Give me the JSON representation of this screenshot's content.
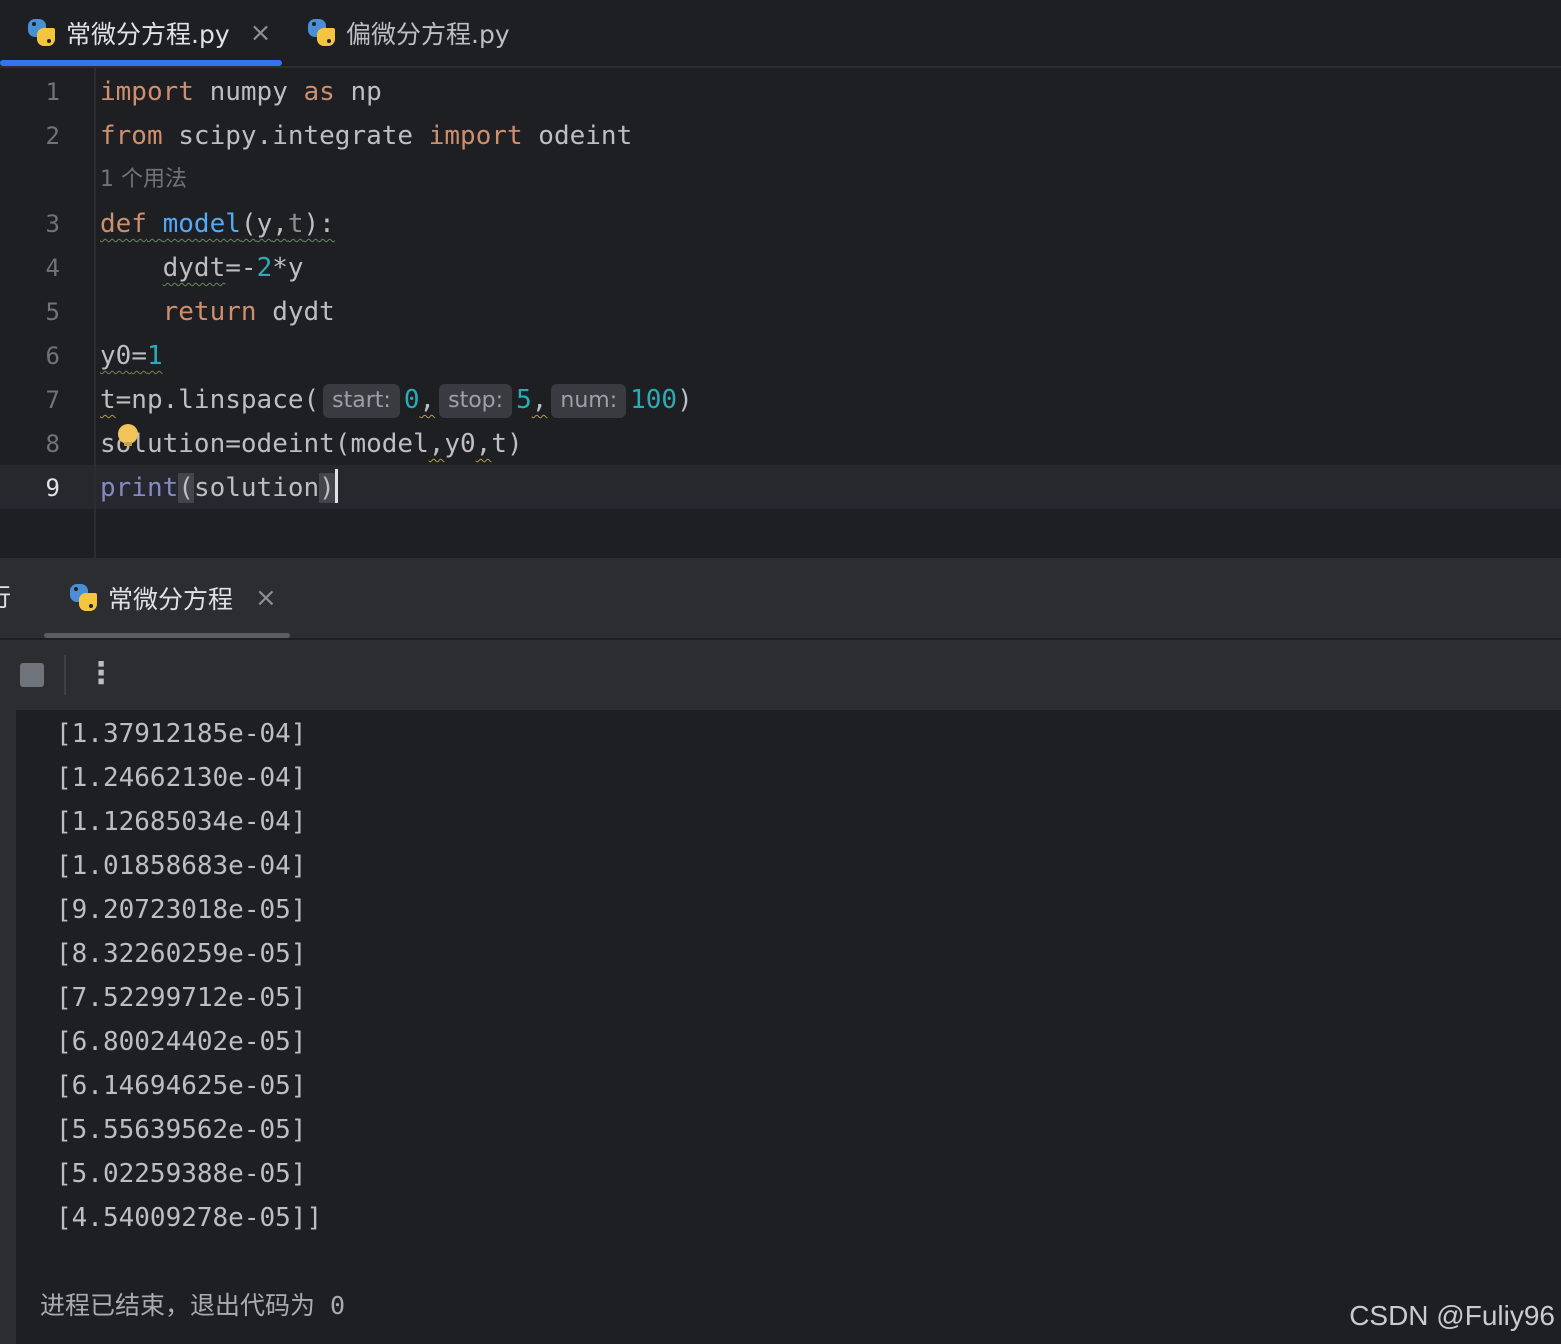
{
  "editor_tabs": [
    {
      "label": "常微分方程.py",
      "active": true,
      "close": "×"
    },
    {
      "label": "偏微分方程.py",
      "active": false
    }
  ],
  "editor": {
    "line_numbers": [
      "1",
      "2",
      "3",
      "4",
      "5",
      "6",
      "7",
      "8",
      "9"
    ],
    "usage_hint": "1 个用法",
    "lines": {
      "l1": {
        "kw1": "import",
        "t1": " numpy ",
        "kw2": "as",
        "t2": " np"
      },
      "l2": {
        "kw1": "from",
        "t1": " scipy.integrate ",
        "kw2": "import",
        "t2": " odeint"
      },
      "l3": {
        "kw": "def",
        "sp": " ",
        "fn": "model",
        "p1": "(",
        "a1": "y",
        "c": ",",
        "a2": "t",
        "p2": "):"
      },
      "l4": {
        "indent": "    ",
        "var": "dydt",
        "op": "=-",
        "num": "2",
        "rest": "*y"
      },
      "l5": {
        "indent": "    ",
        "kw": "return",
        "rest": " dydt"
      },
      "l6": {
        "var": "y0",
        "op": "=",
        "num": "1"
      },
      "l7": {
        "a": "t",
        "b": "=np.linspace(",
        "hint1": "start:",
        "n1": "0",
        "c1": ",",
        "hint2": "stop:",
        "n2": "5",
        "c2": ",",
        "hint3": "num:",
        "n3": "100",
        "end": ")"
      },
      "l8": {
        "a": "so",
        "b": "lution=odeint(model",
        "c1": ",",
        "d": "y0",
        "c2": ",",
        "e": "t)"
      },
      "l9": {
        "fn": "print",
        "p1": "(",
        "arg": "solution",
        "p2": ")"
      }
    }
  },
  "run_panel": {
    "title_clip": "行",
    "tab_label": "常微分方程",
    "close": "×",
    "more_icon": "⋮"
  },
  "console": {
    "output_lines": [
      "[1.37912185e-04]",
      "[1.24662130e-04]",
      "[1.12685034e-04]",
      "[1.01858683e-04]",
      "[9.20723018e-05]",
      "[8.32260259e-05]",
      "[7.52299712e-05]",
      "[6.80024402e-05]",
      "[6.14694625e-05]",
      "[5.55639562e-05]",
      "[5.02259388e-05]",
      "[4.54009278e-05]]"
    ],
    "exit_message": "进程已结束，退出代码为 0"
  },
  "watermark": "CSDN @Fuliy96"
}
